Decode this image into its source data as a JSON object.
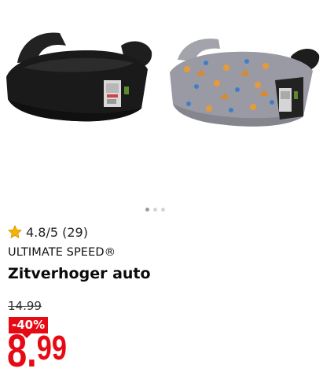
{
  "product": {
    "carousel": {
      "count": 3,
      "active_index": 0
    },
    "rating": {
      "text": "4.8/5 (29)",
      "icon": "star-icon"
    },
    "brand": "ULTIMATE SPEED®",
    "title": "Zitverhoger auto",
    "price": {
      "old": "14.99",
      "discount": "-40%",
      "current_int": "8",
      "current_sep": ".",
      "current_dec": "99"
    }
  },
  "colors": {
    "accent_red": "#e60a14",
    "star": "#f5b400",
    "seat_black": "#1b1b1b",
    "seat_grey": "#9a9aa4"
  }
}
